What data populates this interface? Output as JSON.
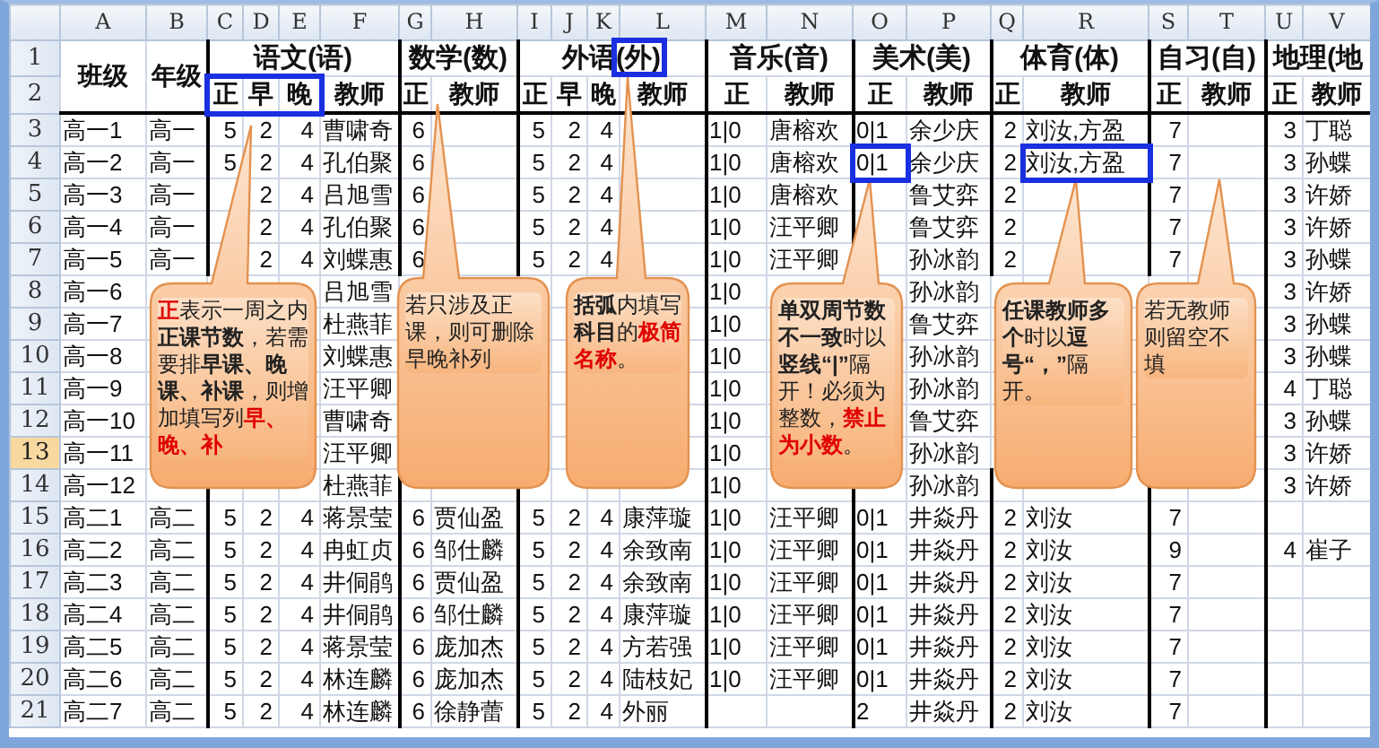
{
  "sheet": {
    "column_letters": [
      "A",
      "B",
      "C",
      "D",
      "E",
      "F",
      "G",
      "H",
      "I",
      "J",
      "K",
      "L",
      "M",
      "N",
      "O",
      "P",
      "Q",
      "R",
      "S",
      "T",
      "U",
      "V"
    ],
    "header_row_numbers": [
      "1",
      "2"
    ],
    "class_header": "班级",
    "grade_header": "年级",
    "groups": [
      {
        "subject": "语文(语)",
        "subheaders": [
          "正",
          "早",
          "晚",
          "教师"
        ]
      },
      {
        "subject": "数学(数)",
        "subheaders": [
          "正",
          "教师"
        ]
      },
      {
        "subject": "外语(外)",
        "subheaders": [
          "正",
          "早",
          "晚",
          "教师"
        ]
      },
      {
        "subject": "音乐(音)",
        "subheaders": [
          "正",
          "教师"
        ]
      },
      {
        "subject": "美术(美)",
        "subheaders": [
          "正",
          "教师"
        ]
      },
      {
        "subject": "体育(体)",
        "subheaders": [
          "正",
          "教师"
        ]
      },
      {
        "subject": "自习(自)",
        "subheaders": [
          "正",
          "教师"
        ]
      },
      {
        "subject": "地理(地",
        "subheaders": [
          "正",
          "教师"
        ]
      }
    ],
    "rows": [
      {
        "number": "3",
        "selected": false,
        "cells": [
          "高一1",
          "高一",
          "5",
          "2",
          "4",
          "曹啸奇",
          "6",
          null,
          "5",
          "2",
          "4",
          null,
          "1|0",
          "唐榕欢",
          "0|1",
          "余少庆",
          "2",
          "刘汝,方盈",
          "7",
          null,
          "3",
          "丁聪"
        ]
      },
      {
        "number": "4",
        "selected": false,
        "cells": [
          "高一2",
          "高一",
          "5",
          "2",
          "4",
          "孔伯聚",
          "6",
          null,
          "5",
          "2",
          "4",
          null,
          "1|0",
          "唐榕欢",
          "0|1",
          "余少庆",
          "2",
          "刘汝,方盈",
          "7",
          null,
          "3",
          "孙蝶"
        ]
      },
      {
        "number": "5",
        "selected": false,
        "cells": [
          "高一3",
          "高一",
          null,
          "2",
          "4",
          "吕旭雪",
          "6",
          null,
          "5",
          "2",
          "4",
          null,
          "1|0",
          "唐榕欢",
          null,
          "鲁艾弈",
          "2",
          null,
          "7",
          null,
          "3",
          "许娇"
        ]
      },
      {
        "number": "6",
        "selected": false,
        "cells": [
          "高一4",
          "高一",
          null,
          "2",
          "4",
          "孔伯聚",
          "6",
          null,
          "5",
          "2",
          "4",
          null,
          "1|0",
          "汪平卿",
          null,
          "鲁艾弈",
          "2",
          null,
          "7",
          null,
          "3",
          "许娇"
        ]
      },
      {
        "number": "7",
        "selected": false,
        "cells": [
          "高一5",
          "高一",
          null,
          "2",
          "4",
          "刘蝶惠",
          "6",
          null,
          "5",
          "2",
          "4",
          null,
          "1|0",
          "汪平卿",
          null,
          "孙冰韵",
          "2",
          null,
          "7",
          null,
          "3",
          "孙蝶"
        ]
      },
      {
        "number": "8",
        "selected": false,
        "cells": [
          "高一6",
          null,
          null,
          null,
          null,
          "吕旭雪",
          null,
          null,
          null,
          null,
          null,
          null,
          "1|0",
          null,
          null,
          "孙冰韵",
          null,
          null,
          null,
          null,
          "3",
          "许娇"
        ]
      },
      {
        "number": "9",
        "selected": false,
        "cells": [
          "高一7",
          null,
          null,
          null,
          null,
          "杜燕菲",
          null,
          null,
          null,
          null,
          null,
          null,
          "1|0",
          null,
          null,
          "鲁艾弈",
          null,
          null,
          null,
          null,
          "3",
          "孙蝶"
        ]
      },
      {
        "number": "10",
        "selected": false,
        "cells": [
          "高一8",
          null,
          null,
          null,
          null,
          "刘蝶惠",
          null,
          null,
          null,
          null,
          null,
          null,
          "1|0",
          null,
          null,
          "孙冰韵",
          null,
          null,
          null,
          null,
          "3",
          "孙蝶"
        ]
      },
      {
        "number": "11",
        "selected": false,
        "cells": [
          "高一9",
          null,
          null,
          null,
          null,
          "汪平卿",
          null,
          null,
          null,
          null,
          null,
          null,
          "1|0",
          null,
          null,
          "孙冰韵",
          null,
          null,
          null,
          null,
          "4",
          "丁聪"
        ]
      },
      {
        "number": "12",
        "selected": false,
        "cells": [
          "高一10",
          null,
          null,
          null,
          null,
          "曹啸奇",
          null,
          null,
          null,
          null,
          null,
          null,
          "1|0",
          null,
          null,
          "鲁艾弈",
          null,
          null,
          null,
          null,
          "3",
          "孙蝶"
        ]
      },
      {
        "number": "13",
        "selected": true,
        "cells": [
          "高一11",
          null,
          null,
          null,
          null,
          "汪平卿",
          null,
          null,
          null,
          null,
          null,
          null,
          "1|0",
          null,
          null,
          "孙冰韵",
          null,
          null,
          null,
          null,
          "3",
          "许娇"
        ]
      },
      {
        "number": "14",
        "selected": false,
        "cells": [
          "高一12",
          null,
          null,
          null,
          null,
          "杜燕菲",
          null,
          null,
          null,
          null,
          null,
          null,
          "1|0",
          null,
          null,
          "孙冰韵",
          null,
          null,
          null,
          null,
          "3",
          "许娇"
        ]
      },
      {
        "number": "15",
        "selected": false,
        "cells": [
          "高二1",
          "高二",
          "5",
          "2",
          "4",
          "蒋景莹",
          "6",
          "贾仙盈",
          "5",
          "2",
          "4",
          "康萍璇",
          "1|0",
          "汪平卿",
          "0|1",
          "井焱丹",
          "2",
          "刘汝",
          "7",
          null,
          null,
          null
        ]
      },
      {
        "number": "16",
        "selected": false,
        "cells": [
          "高二2",
          "高二",
          "5",
          "2",
          "4",
          "冉虹贞",
          "6",
          "邹仕麟",
          "5",
          "2",
          "4",
          "余致南",
          "1|0",
          "汪平卿",
          "0|1",
          "井焱丹",
          "2",
          "刘汝",
          "9",
          null,
          "4",
          "崔子"
        ]
      },
      {
        "number": "17",
        "selected": false,
        "cells": [
          "高二3",
          "高二",
          "5",
          "2",
          "4",
          "井侗鹃",
          "6",
          "贾仙盈",
          "5",
          "2",
          "4",
          "余致南",
          "1|0",
          "汪平卿",
          "0|1",
          "井焱丹",
          "2",
          "刘汝",
          "7",
          null,
          null,
          null
        ]
      },
      {
        "number": "18",
        "selected": false,
        "cells": [
          "高二4",
          "高二",
          "5",
          "2",
          "4",
          "井侗鹃",
          "6",
          "邹仕麟",
          "5",
          "2",
          "4",
          "康萍璇",
          "1|0",
          "汪平卿",
          "0|1",
          "井焱丹",
          "2",
          "刘汝",
          "7",
          null,
          null,
          null
        ]
      },
      {
        "number": "19",
        "selected": false,
        "cells": [
          "高二5",
          "高二",
          "5",
          "2",
          "4",
          "蒋景莹",
          "6",
          "庞加杰",
          "5",
          "2",
          "4",
          "方若强",
          "1|0",
          "汪平卿",
          "0|1",
          "井焱丹",
          "2",
          "刘汝",
          "7",
          null,
          null,
          null
        ]
      },
      {
        "number": "20",
        "selected": false,
        "cells": [
          "高二6",
          "高二",
          "5",
          "2",
          "4",
          "林连麟",
          "6",
          "庞加杰",
          "5",
          "2",
          "4",
          "陆枝妃",
          "1|0",
          "汪平卿",
          "0|1",
          "井焱丹",
          "2",
          "刘汝",
          "7",
          null,
          null,
          null
        ]
      },
      {
        "number": "21",
        "selected": false,
        "cells": [
          "高二7",
          "高二",
          "5",
          "2",
          "4",
          "林连麟",
          "6",
          "徐静蕾",
          "5",
          "2",
          "4",
          "外丽",
          null,
          null,
          "2",
          "井焱丹",
          "2",
          "刘汝",
          "7",
          null,
          null,
          null
        ]
      }
    ]
  },
  "callouts": [
    {
      "runs": [
        {
          "text": "正",
          "kind": "highlight"
        },
        {
          "text": "表示一周之内",
          "kind": "plain"
        },
        {
          "text": "正课节数",
          "kind": "bold"
        },
        {
          "text": "，若需要排",
          "kind": "plain"
        },
        {
          "text": "早课、晚课、补课",
          "kind": "bold"
        },
        {
          "text": "，则增加填写列",
          "kind": "plain"
        },
        {
          "text": "早、晚、补",
          "kind": "highlight"
        }
      ]
    },
    {
      "runs": [
        {
          "text": "若只涉及正课，则可删除早晚补列",
          "kind": "plain"
        }
      ]
    },
    {
      "runs": [
        {
          "text": "括弧",
          "kind": "bold"
        },
        {
          "text": "内填写",
          "kind": "plain"
        },
        {
          "text": "科目",
          "kind": "bold"
        },
        {
          "text": "的",
          "kind": "plain"
        },
        {
          "text": "极简名称",
          "kind": "highlight"
        },
        {
          "text": "。",
          "kind": "plain"
        }
      ]
    },
    {
      "runs": [
        {
          "text": "单双周节数不一致",
          "kind": "bold"
        },
        {
          "text": "时以",
          "kind": "plain"
        },
        {
          "text": "竖线“|”",
          "kind": "bold"
        },
        {
          "text": "隔开！必须为整数，",
          "kind": "plain"
        },
        {
          "text": "禁止为小数",
          "kind": "highlight"
        },
        {
          "text": "。",
          "kind": "plain"
        }
      ]
    },
    {
      "runs": [
        {
          "text": "任课教师多个",
          "kind": "bold"
        },
        {
          "text": "时以",
          "kind": "plain"
        },
        {
          "text": "逗号“，”",
          "kind": "bold"
        },
        {
          "text": "隔开。",
          "kind": "plain"
        }
      ]
    },
    {
      "runs": [
        {
          "text": "若无教师则留空不填",
          "kind": "plain"
        }
      ]
    }
  ]
}
